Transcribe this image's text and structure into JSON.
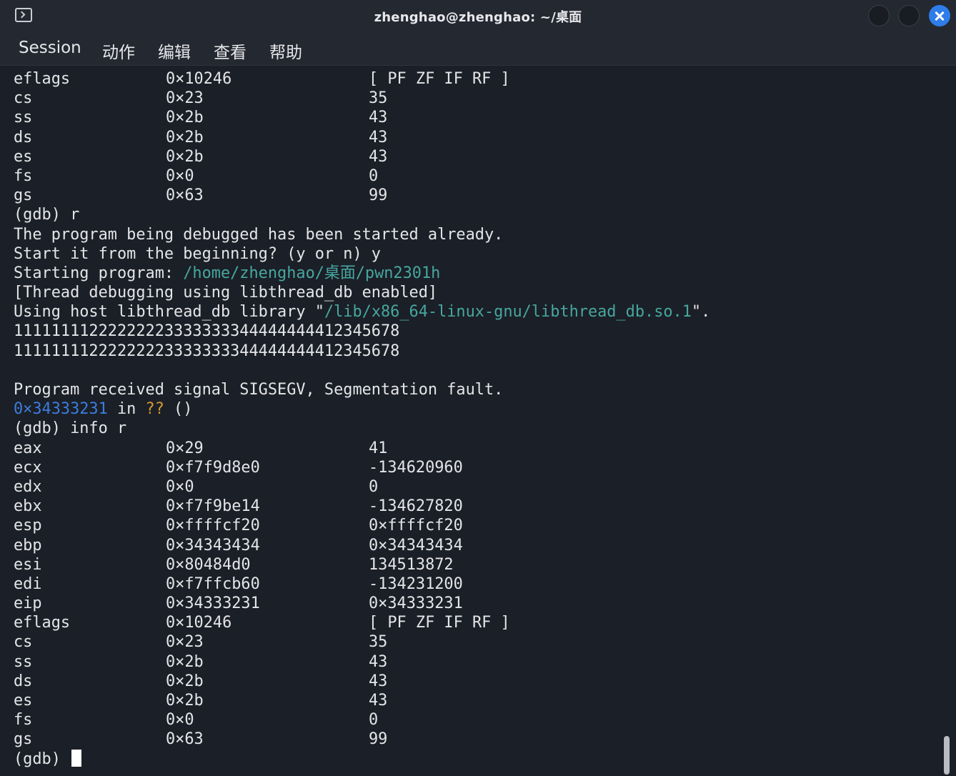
{
  "window": {
    "title": "zhenghao@zhenghao: ~/桌面"
  },
  "menu": {
    "items": [
      "Session",
      "动作",
      "编辑",
      "查看",
      "帮助"
    ]
  },
  "colors": {
    "background": "#1b1f27",
    "text": "#e4e5e8",
    "path": "#47a7a0",
    "address": "#3b7ddd",
    "unknown_symbol": "#d99a2c",
    "close_button": "#2e7de8"
  },
  "terminal": {
    "registers_top": [
      {
        "name": "eflags",
        "hex": "0×10246",
        "value": "[ PF ZF IF RF ]"
      },
      {
        "name": "cs",
        "hex": "0×23",
        "value": "35"
      },
      {
        "name": "ss",
        "hex": "0×2b",
        "value": "43"
      },
      {
        "name": "ds",
        "hex": "0×2b",
        "value": "43"
      },
      {
        "name": "es",
        "hex": "0×2b",
        "value": "43"
      },
      {
        "name": "fs",
        "hex": "0×0",
        "value": "0"
      },
      {
        "name": "gs",
        "hex": "0×63",
        "value": "99"
      }
    ],
    "cmd_run": "(gdb) r",
    "msg_started": "The program being debugged has been started already.",
    "msg_restart": "Start it from the beginning? (y or n) y",
    "starting_prefix": "Starting program: ",
    "starting_path": "/home/zhenghao/桌面/pwn2301h",
    "thread_msg": "[Thread debugging using libthread_db enabled]",
    "host_prefix": "Using host libthread_db library \"",
    "host_path": "/lib/x86_64-linux-gnu/libthread_db.so.1",
    "host_suffix": "\".",
    "output_1": "11111111222222223333333344444444412345678",
    "output_2": "11111111222222223333333344444444412345678",
    "signal_msg": "Program received signal SIGSEGV, Segmentation fault.",
    "fault_addr": "0×34333231",
    "fault_in": " in ",
    "fault_sym": "??",
    "fault_paren": " ()",
    "cmd_info": "(gdb) info r",
    "registers_bottom": [
      {
        "name": "eax",
        "hex": "0×29",
        "value": "41"
      },
      {
        "name": "ecx",
        "hex": "0×f7f9d8e0",
        "value": "-134620960"
      },
      {
        "name": "edx",
        "hex": "0×0",
        "value": "0"
      },
      {
        "name": "ebx",
        "hex": "0×f7f9be14",
        "value": "-134627820"
      },
      {
        "name": "esp",
        "hex": "0×ffffcf20",
        "value": "0×ffffcf20"
      },
      {
        "name": "ebp",
        "hex": "0×34343434",
        "value": "0×34343434"
      },
      {
        "name": "esi",
        "hex": "0×80484d0",
        "value": "134513872"
      },
      {
        "name": "edi",
        "hex": "0×f7ffcb60",
        "value": "-134231200"
      },
      {
        "name": "eip",
        "hex": "0×34333231",
        "value": "0×34333231"
      },
      {
        "name": "eflags",
        "hex": "0×10246",
        "value": "[ PF ZF IF RF ]"
      },
      {
        "name": "cs",
        "hex": "0×23",
        "value": "35"
      },
      {
        "name": "ss",
        "hex": "0×2b",
        "value": "43"
      },
      {
        "name": "ds",
        "hex": "0×2b",
        "value": "43"
      },
      {
        "name": "es",
        "hex": "0×2b",
        "value": "43"
      },
      {
        "name": "fs",
        "hex": "0×0",
        "value": "0"
      },
      {
        "name": "gs",
        "hex": "0×63",
        "value": "99"
      }
    ],
    "prompt": "(gdb) "
  }
}
